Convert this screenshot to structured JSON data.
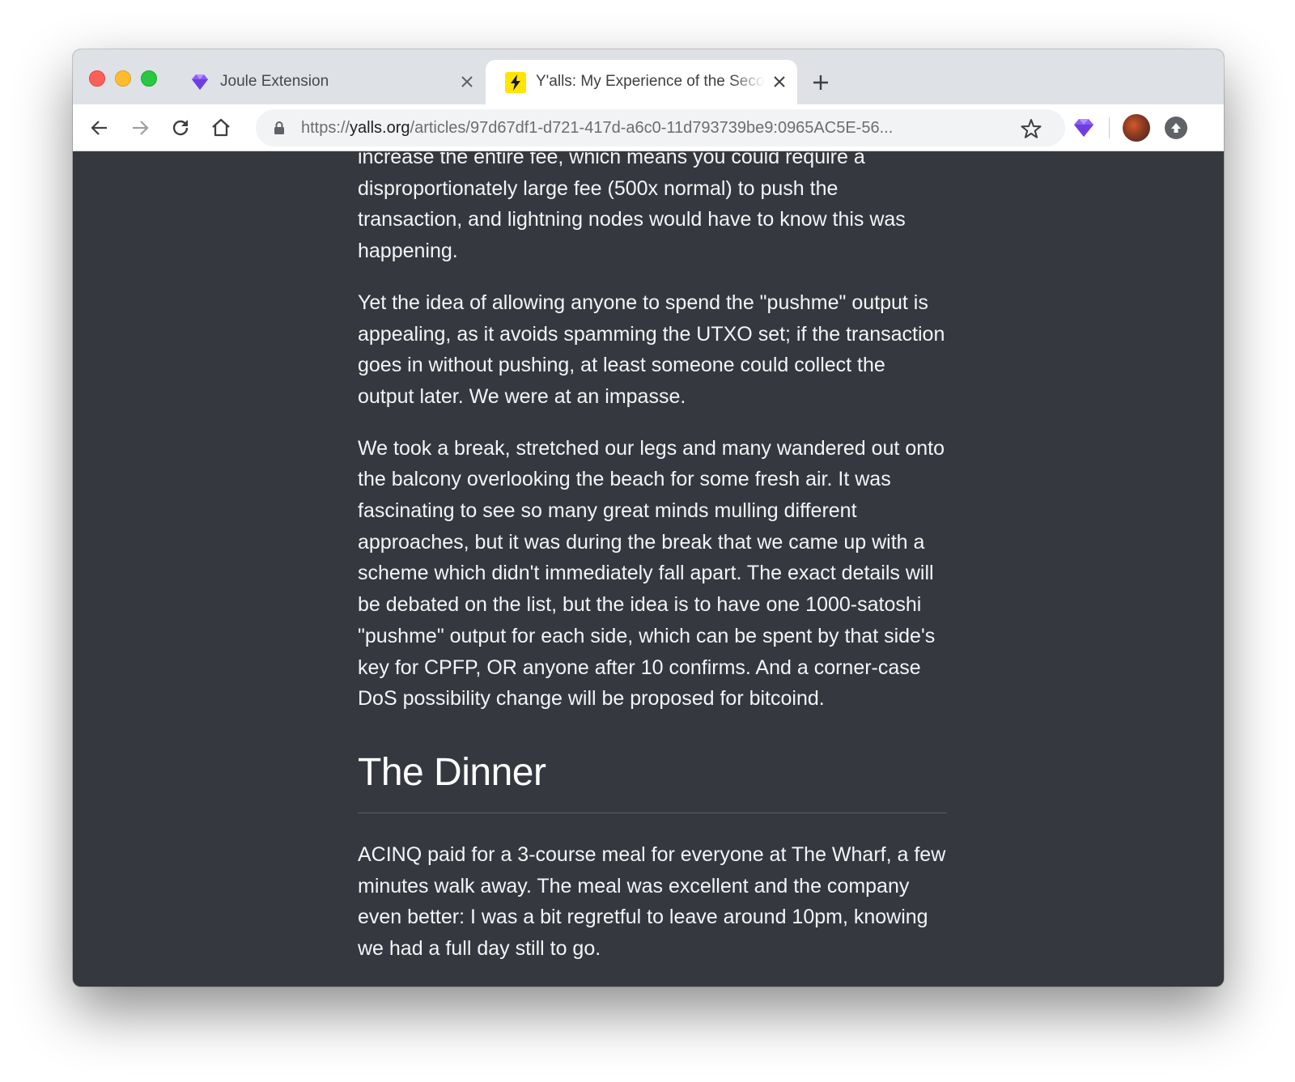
{
  "browser": {
    "tabs": [
      {
        "title": "Joule Extension",
        "active": false,
        "icon": "joule-diamond-icon"
      },
      {
        "title": "Y'alls: My Experience of the Second Lightning Summit",
        "active": true,
        "icon": "yalls-lightning-icon"
      }
    ],
    "address_bar": {
      "scheme": "https://",
      "host": "yalls.org",
      "path": "/articles/97d67df1-d721-417d-a6c0-11d793739be9:0965AC5E-56..."
    },
    "colors": {
      "accent_purple": "#8b5cf6",
      "yalls_yellow": "#ffe500",
      "page_background": "#35383f"
    }
  },
  "article": {
    "paragraphs_before": [
      "increase the entire fee, which means you could require a disproportionately large fee (500x normal) to push the transaction, and lightning nodes would have to know this was happening.",
      "Yet the idea of allowing anyone to spend the \"pushme\" output is appealing, as it avoids spamming the UTXO set; if the transaction goes in without pushing, at least someone could collect the output later. We were at an impasse.",
      "We took a break, stretched our legs and many wandered out onto the balcony overlooking the beach for some fresh air. It was fascinating to see so many great minds mulling different approaches, but it was during the break that we came up with a scheme which didn't immediately fall apart. The exact details will be debated on the list, but the idea is to have one 1000-satoshi \"pushme\" output for each side, which can be spent by that side's key for CPFP, OR anyone after 10 confirms. And a corner-case DoS possibility change will be proposed for bitcoind."
    ],
    "heading": "The Dinner",
    "paragraph_after": "ACINQ paid for a 3-course meal for everyone at The Wharf, a few minutes walk away. The meal was excellent and the company even better: I was a bit regretful to leave around 10pm, knowing we had a full day still to go."
  }
}
